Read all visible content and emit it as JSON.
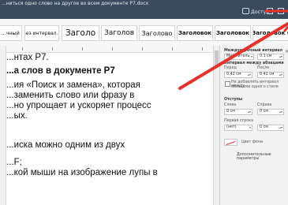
{
  "window": {
    "title": "...ниться одно слово на другое во всем документе Р7.docx",
    "account": "Доступ"
  },
  "ribbon": {
    "styles": [
      {
        "label": "...чный"
      },
      {
        "label": "Без интервал..."
      },
      {
        "label": "Заголо"
      },
      {
        "label": "Заголов"
      },
      {
        "label": "Заголово"
      },
      {
        "label": "Заголовок"
      },
      {
        "label": "Заголовок"
      },
      {
        "label": "Заголовок 6"
      }
    ]
  },
  "document": {
    "lines": [
      "...нтах Р7.",
      "...а слов в документе Р7",
      "...ия «Поиск и замена», которая",
      "...заменить слово или фразу в",
      "...но упрощает и ускоряет процесс",
      "...ых.",
      "...иска можно одним из двух",
      "...F;",
      "...кой мыши на изображение лупы в"
    ]
  },
  "paragraph_settings": {
    "line_spacing": {
      "section": "Междустрочный интервал",
      "type": "Множитель",
      "value": "0.1 см"
    },
    "paragraph_spacing": {
      "section": "Интервал между абзацами",
      "before_label": "Перед",
      "after_label": "После",
      "before_value": "0.42 см",
      "after_value": "0.42 см",
      "no_interval_label": "Не добавлять интервал между",
      "no_interval_label2": "абзацами одного стиля"
    },
    "indents": {
      "section": "Отступы",
      "left_label": "Слева",
      "right_label": "Справа",
      "left_value": "0 см",
      "right_value": "0 см",
      "first_line_label": "Первая строка",
      "first_line_type": "(нет)",
      "first_line_value": "0 см"
    },
    "shading_label": "Цвет фона",
    "advanced_label": "Дополнительные параметры"
  }
}
